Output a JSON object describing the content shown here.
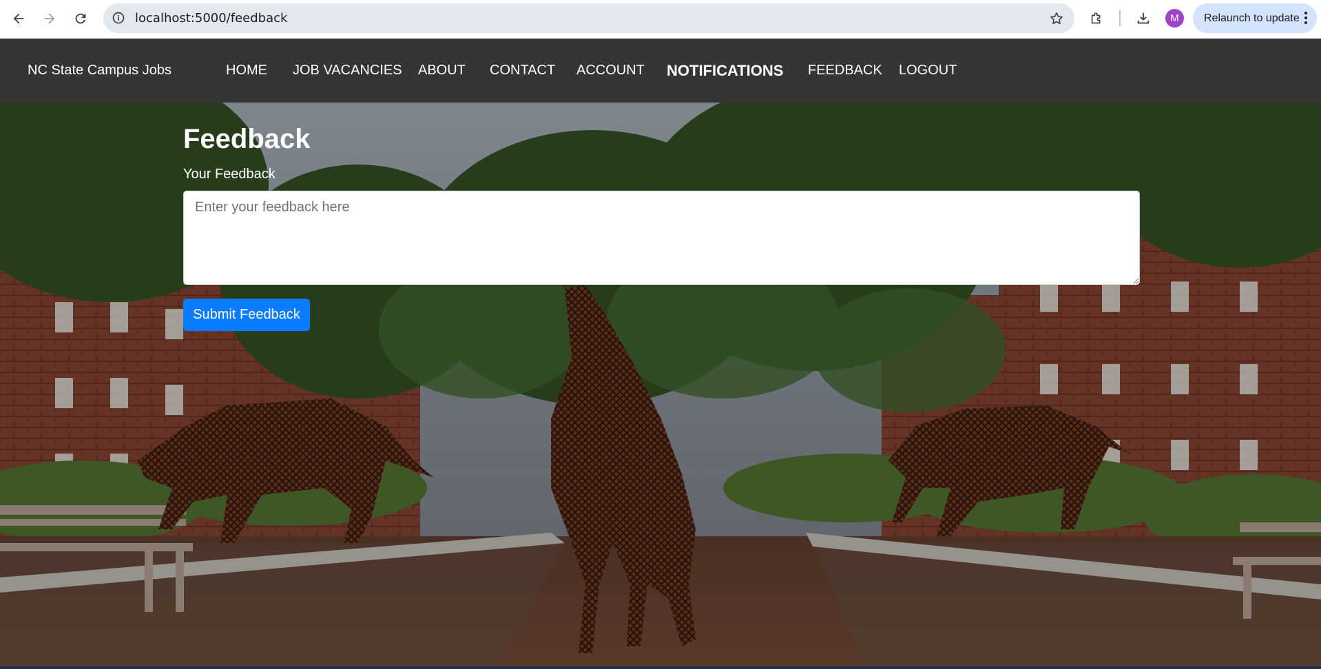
{
  "browser": {
    "url": "localhost:5000/feedback",
    "profile_initial": "M",
    "relaunch_label": "Relaunch to update",
    "icons": [
      "back-icon",
      "forward-icon",
      "reload-icon",
      "site-info-icon",
      "bookmark-star-icon",
      "extensions-icon",
      "download-icon",
      "more-menu-icon"
    ]
  },
  "navbar": {
    "brand": "NC State Campus Jobs",
    "links": [
      {
        "label": "HOME"
      },
      {
        "label": "JOB VACANCIES"
      },
      {
        "label": "ABOUT"
      },
      {
        "label": "CONTACT"
      },
      {
        "label": "ACCOUNT"
      },
      {
        "label": "NOTIFICATIONS",
        "active": true
      },
      {
        "label": "FEEDBACK"
      },
      {
        "label": "LOGOUT"
      }
    ]
  },
  "form": {
    "title": "Feedback",
    "label": "Your Feedback",
    "placeholder": "Enter your feedback here",
    "value": "",
    "submit_label": "Submit Feedback"
  },
  "colors": {
    "navbar_bg": "#353535",
    "primary_button": "#0b7cfe",
    "omnibox_bg": "#e3e7ee",
    "relaunch_bg": "#d3e3fd",
    "avatar_bg": "#a142c8"
  }
}
